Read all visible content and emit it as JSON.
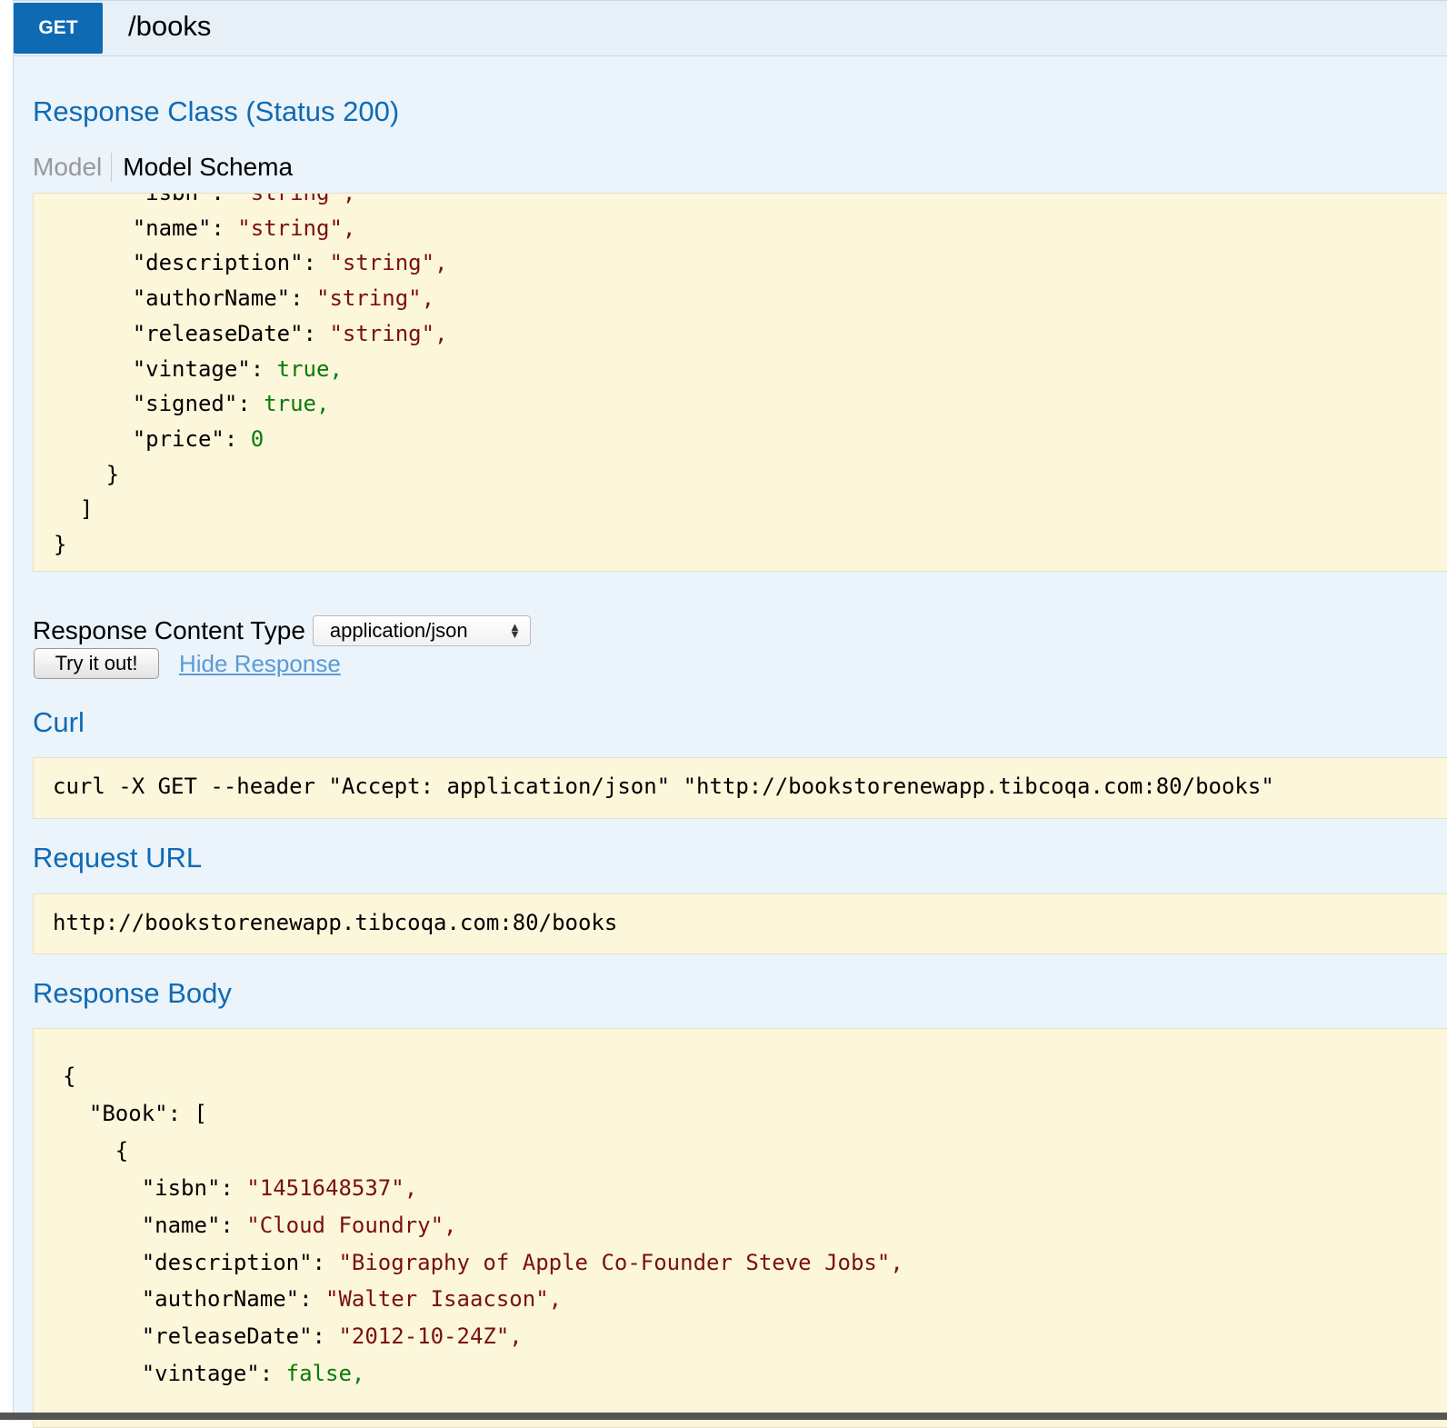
{
  "operation": {
    "verb": "GET",
    "path": "/books"
  },
  "response_class": {
    "title": "Response Class (Status 200)",
    "tabs": [
      {
        "label": "Model",
        "active": false
      },
      {
        "label": "Model Schema",
        "active": true
      }
    ],
    "schema_lines": [
      {
        "indent": 6,
        "key": "\"isbn\"",
        "val": "\"string\",",
        "kind": "s"
      },
      {
        "indent": 6,
        "key": "\"name\"",
        "val": "\"string\",",
        "kind": "s"
      },
      {
        "indent": 6,
        "key": "\"description\"",
        "val": "\"string\",",
        "kind": "s"
      },
      {
        "indent": 6,
        "key": "\"authorName\"",
        "val": "\"string\",",
        "kind": "s"
      },
      {
        "indent": 6,
        "key": "\"releaseDate\"",
        "val": "\"string\",",
        "kind": "s"
      },
      {
        "indent": 6,
        "key": "\"vintage\"",
        "val": "true,",
        "kind": "b"
      },
      {
        "indent": 6,
        "key": "\"signed\"",
        "val": "true,",
        "kind": "b"
      },
      {
        "indent": 6,
        "key": "\"price\"",
        "val": "0",
        "kind": "b"
      },
      {
        "indent": 4,
        "raw": "}"
      },
      {
        "indent": 2,
        "raw": "]"
      },
      {
        "indent": 0,
        "raw": "}"
      }
    ]
  },
  "content_type": {
    "label": "Response Content Type",
    "selected": "application/json"
  },
  "actions": {
    "try_label": "Try it out!",
    "hide_label": "Hide Response"
  },
  "curl": {
    "title": "Curl",
    "command": "curl -X GET --header \"Accept: application/json\" \"http://bookstorenewapp.tibcoqa.com:80/books\""
  },
  "request_url": {
    "title": "Request URL",
    "url": "http://bookstorenewapp.tibcoqa.com:80/books"
  },
  "response_body": {
    "title": "Response Body",
    "lines": [
      {
        "indent": 0,
        "raw": "{"
      },
      {
        "indent": 2,
        "key": "\"Book\"",
        "val": "[",
        "kind": "p"
      },
      {
        "indent": 4,
        "raw": "{"
      },
      {
        "indent": 6,
        "key": "\"isbn\"",
        "val": "\"1451648537\",",
        "kind": "s"
      },
      {
        "indent": 6,
        "key": "\"name\"",
        "val": "\"Cloud Foundry\",",
        "kind": "s"
      },
      {
        "indent": 6,
        "key": "\"description\"",
        "val": "\"Biography of Apple Co-Founder Steve Jobs\",",
        "kind": "s"
      },
      {
        "indent": 6,
        "key": "\"authorName\"",
        "val": "\"Walter Isaacson\",",
        "kind": "s"
      },
      {
        "indent": 6,
        "key": "\"releaseDate\"",
        "val": "\"2012-10-24Z\",",
        "kind": "s"
      },
      {
        "indent": 6,
        "key": "\"vintage\"",
        "val": "false,",
        "kind": "b"
      }
    ]
  },
  "colors": {
    "accent": "#0f6ab4",
    "code_bg": "#fcf6db",
    "string": "#7a1010",
    "literal": "#0a7a0a"
  }
}
